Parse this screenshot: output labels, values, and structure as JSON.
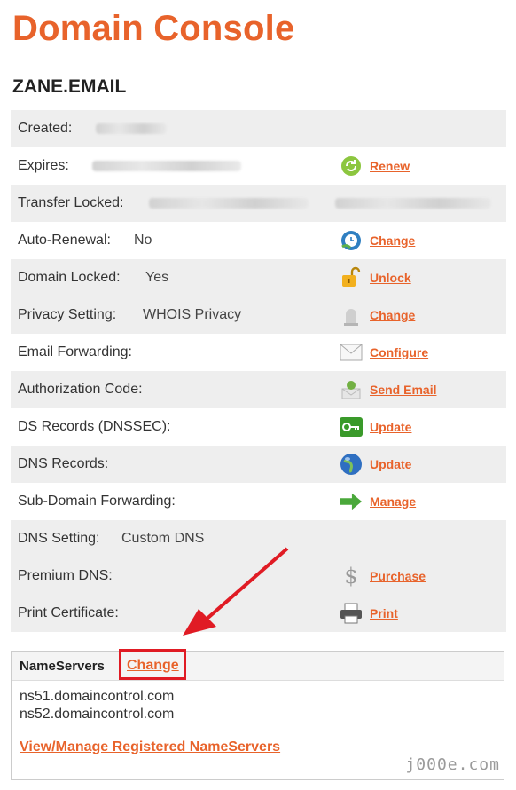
{
  "page": {
    "title": "Domain Console",
    "domain": "ZANE.EMAIL"
  },
  "rows": [
    {
      "label": "Created:",
      "value": "",
      "action": "",
      "icon": ""
    },
    {
      "label": "Expires:",
      "value": "",
      "action": "Renew",
      "icon": "renew-icon"
    },
    {
      "label": "Transfer Locked:",
      "value": "",
      "action": "",
      "icon": ""
    },
    {
      "label": "Auto-Renewal:",
      "value": "No",
      "action": "Change",
      "icon": "clock-globe-icon"
    },
    {
      "label": "Domain Locked:",
      "value": "Yes",
      "action": "Unlock",
      "icon": "padlock-icon"
    },
    {
      "label": "Privacy Setting:",
      "value": "WHOIS Privacy",
      "action": "Change",
      "icon": "privacy-icon"
    },
    {
      "label": "Email Forwarding:",
      "value": "",
      "action": "Configure",
      "icon": "envelope-icon"
    },
    {
      "label": "Authorization Code:",
      "value": "",
      "action": "Send Email",
      "icon": "send-email-icon"
    },
    {
      "label": "DS Records (DNSSEC):",
      "value": "",
      "action": "Update",
      "icon": "key-icon"
    },
    {
      "label": "DNS Records:",
      "value": "",
      "action": "Update",
      "icon": "globe-icon"
    },
    {
      "label": "Sub-Domain Forwarding:",
      "value": "",
      "action": "Manage",
      "icon": "forward-arrow-icon"
    },
    {
      "label": "DNS Setting:",
      "value": "Custom DNS",
      "action": "",
      "icon": ""
    },
    {
      "label": "Premium DNS:",
      "value": "",
      "action": "Purchase",
      "icon": "dollar-icon"
    },
    {
      "label": "Print Certificate:",
      "value": "",
      "action": "Print",
      "icon": "printer-icon"
    }
  ],
  "nameservers": {
    "title": "NameServers",
    "change_label": "Change",
    "servers": [
      "ns51.domaincontrol.com",
      "ns52.domaincontrol.com"
    ],
    "manage_link": "View/Manage Registered NameServers"
  },
  "watermark": "j000e.com",
  "colors": {
    "accent": "#e8632b",
    "highlight": "#e01b24",
    "row_shade": "#eeeeee"
  }
}
